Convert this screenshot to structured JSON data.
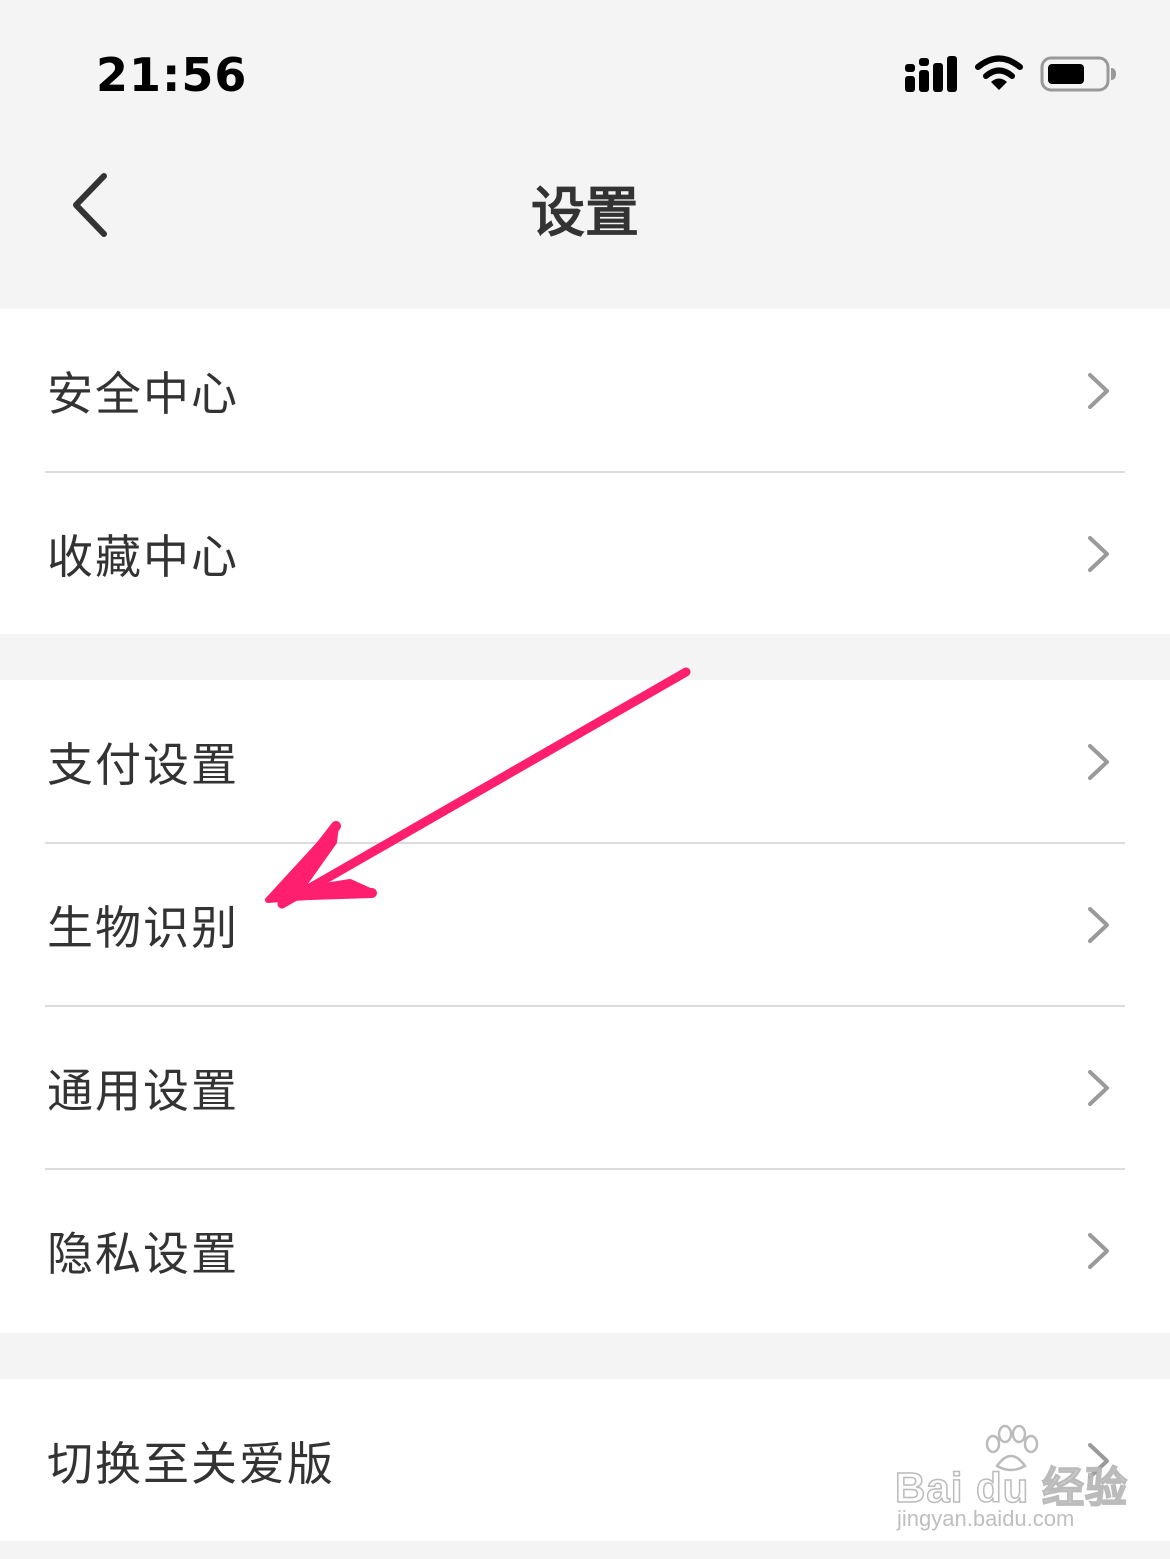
{
  "status_bar": {
    "time": "21:56",
    "icons": [
      "cellular-signal-icon",
      "wifi-icon",
      "battery-icon"
    ]
  },
  "nav": {
    "title": "设置",
    "back_icon": "chevron-left-icon"
  },
  "groups": [
    {
      "items": [
        {
          "label": "安全中心"
        },
        {
          "label": "收藏中心"
        }
      ]
    },
    {
      "items": [
        {
          "label": "支付设置"
        },
        {
          "label": "生物识别"
        },
        {
          "label": "通用设置"
        },
        {
          "label": "隐私设置"
        }
      ]
    },
    {
      "items": [
        {
          "label": "切换至关爱版"
        }
      ]
    }
  ],
  "annotation": {
    "type": "arrow",
    "color": "#ff1f6e",
    "points_to": "生物识别"
  },
  "watermark": {
    "brand": "Bai du 经验",
    "url": "jingyan.baidu.com"
  },
  "colors": {
    "background": "#f4f4f4",
    "row_background": "#ffffff",
    "text": "#333333",
    "divider": "#dcdcdc",
    "chevron": "#9a9a9a"
  }
}
